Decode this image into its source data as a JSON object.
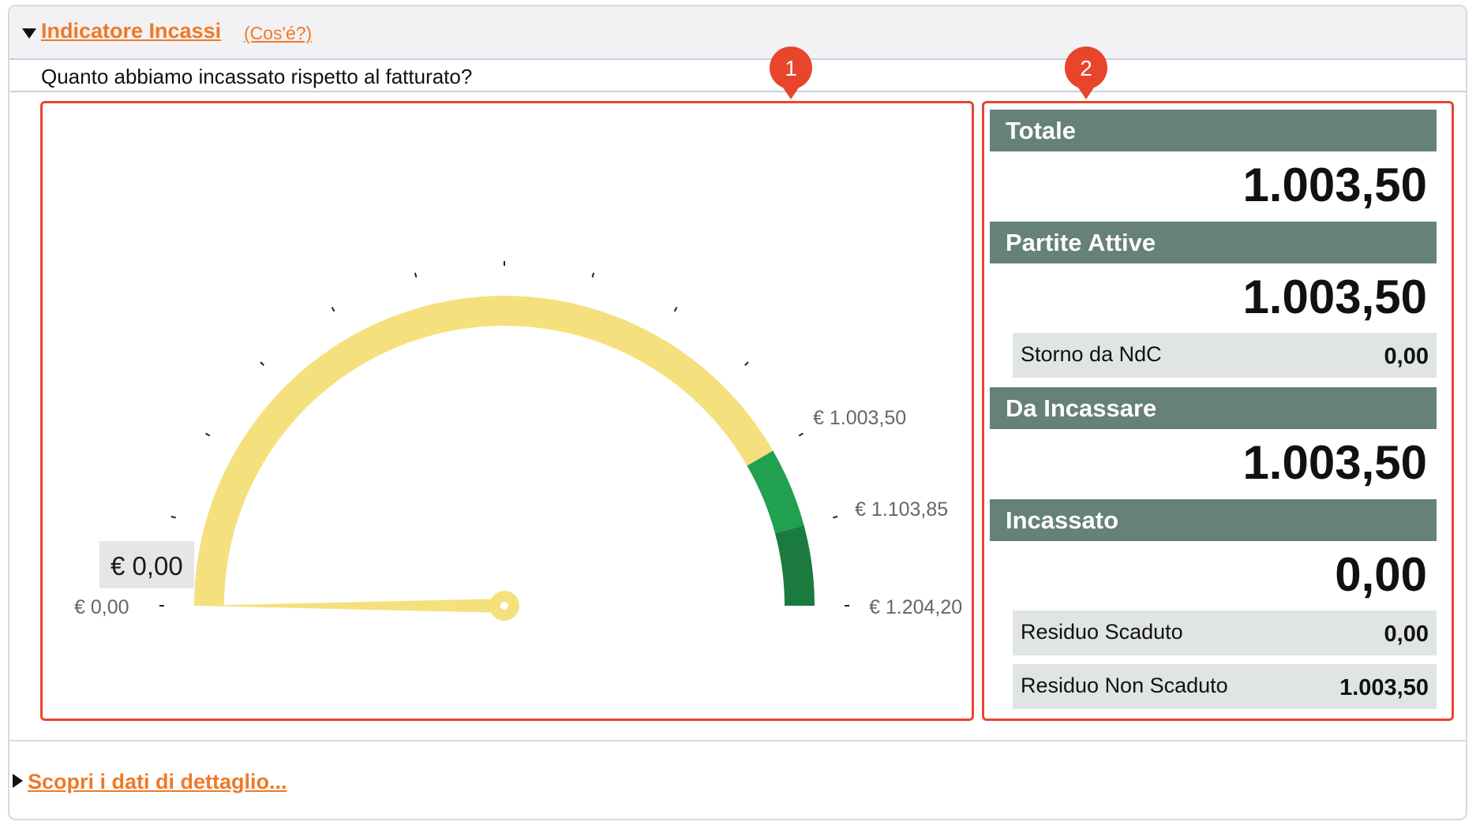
{
  "header": {
    "title": "Indicatore Incassi",
    "help_link": "(Cos'é?)",
    "question": "Quanto abbiamo incassato rispetto al fatturato?"
  },
  "callouts": [
    "1",
    "2"
  ],
  "gauge": {
    "value_label": "€ 0,00",
    "value": 0,
    "min": 0,
    "max": 1204.2,
    "label_min": "€ 0,00",
    "label_1": "€ 1.003,50",
    "label_2": "€ 1.103,85",
    "label_max": "€ 1.204,20",
    "colors": {
      "yellow": "#f5e07e",
      "green": "#21a050",
      "dark_green": "#1b7a3e"
    }
  },
  "stats": {
    "totale": {
      "label": "Totale",
      "value": "1.003,50"
    },
    "partite_attive": {
      "label": "Partite Attive",
      "value": "1.003,50",
      "storno_label": "Storno da NdC",
      "storno_value": "0,00"
    },
    "da_incassare": {
      "label": "Da Incassare",
      "value": "1.003,50"
    },
    "incassato": {
      "label": "Incassato",
      "value": "0,00",
      "residuo_scaduto_label": "Residuo Scaduto",
      "residuo_scaduto_value": "0,00",
      "residuo_non_scaduto_label": "Residuo Non Scaduto",
      "residuo_non_scaduto_value": "1.003,50"
    }
  },
  "footer": {
    "detail_link": "Scopri i dati di dettaglio..."
  },
  "colors": {
    "accent": "#f07826",
    "highlight": "#e8452c",
    "stat_header": "#66807a",
    "stat_sub": "#e1e4e4"
  }
}
